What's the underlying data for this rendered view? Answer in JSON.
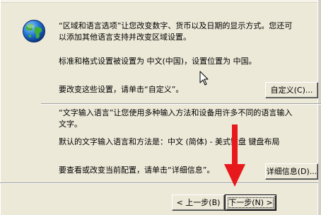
{
  "section1": {
    "line1": "“区域和语言选项”让您改变数字、货币以及日期的显示方式。您还可",
    "line2": "以添加其他语言支持并改变区域设置。",
    "current_settings": "标准和格式设置被设置为 中文(中国)，设置位置为 中国。",
    "change_prompt": "要改变这些设置，请单击“自定义”。",
    "customize_button": "自定义(C)..."
  },
  "section2": {
    "line1": "“文字输入语言”让您使用多种输入方法和设备用许多不同的语言输入",
    "line2": "文字。",
    "default_input": "默认的文字输入语言和方法是：中文 (简体) - 美式键盘 键盘布局",
    "details_prompt": "要查看或改变当前配置，请单击“详细信息”。",
    "details_button": "详细信息(D)..."
  },
  "wizard": {
    "back_button": "< 上一步(B)",
    "next_button": "下一步(N) >"
  },
  "icons": {
    "globe": "globe-icon",
    "cursor": "mouse-cursor-icon",
    "annotation": "red-arrow-icon"
  },
  "colors": {
    "dialog_bg": "#ece9d8",
    "arrow": "#e8191c"
  }
}
